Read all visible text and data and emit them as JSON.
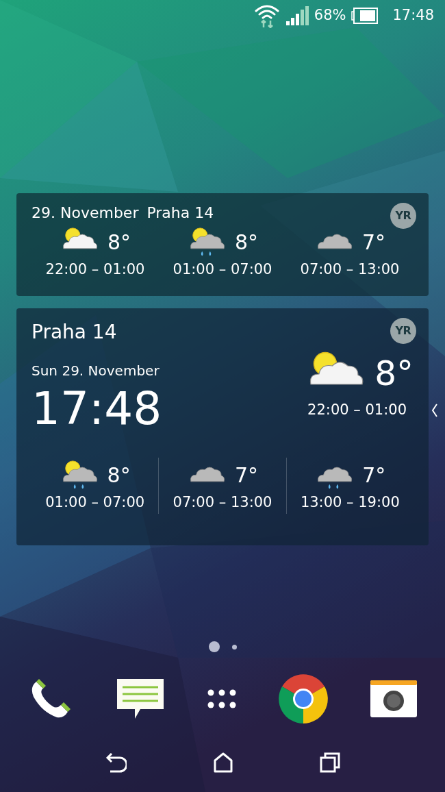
{
  "status_bar": {
    "battery": "68%",
    "time": "17:48"
  },
  "widget_small": {
    "date": "29. November",
    "location": "Praha 14",
    "logo": "YR",
    "forecasts": [
      {
        "kind": "partly_cloudy",
        "temp": "8°",
        "period": "22:00 – 01:00"
      },
      {
        "kind": "partly_cloudy_rain",
        "temp": "8°",
        "period": "01:00 – 07:00"
      },
      {
        "kind": "cloudy",
        "temp": "7°",
        "period": "07:00 – 13:00"
      }
    ]
  },
  "widget_large": {
    "location": "Praha 14",
    "logo": "YR",
    "date": "Sun 29. November",
    "clock": "17:48",
    "now": {
      "kind": "partly_cloudy",
      "temp": "8°",
      "period": "22:00 – 01:00"
    },
    "forecasts": [
      {
        "kind": "partly_cloudy_rain",
        "temp": "8°",
        "period": "01:00 – 07:00"
      },
      {
        "kind": "cloudy",
        "temp": "7°",
        "period": "07:00 – 13:00"
      },
      {
        "kind": "rain",
        "temp": "7°",
        "period": "13:00 – 19:00"
      }
    ]
  },
  "page_indicator": [
    {
      "selected": true
    },
    {
      "selected": false
    }
  ]
}
